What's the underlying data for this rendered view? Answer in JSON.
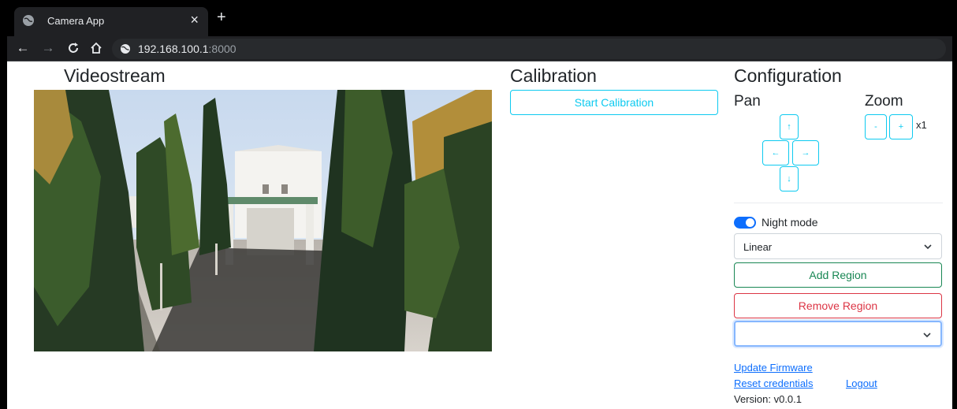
{
  "browser": {
    "tab_title": "Camera App",
    "tab_close": "×",
    "new_tab": "+",
    "url_host": "192.168.100.1",
    "url_port": ":8000"
  },
  "videostream": {
    "title": "Videostream"
  },
  "calibration": {
    "title": "Calibration",
    "start_label": "Start Calibration"
  },
  "configuration": {
    "title": "Configuration",
    "pan": {
      "title": "Pan",
      "up": "↑",
      "left": "←",
      "right": "→",
      "down": "↓"
    },
    "zoom": {
      "title": "Zoom",
      "minus": "-",
      "plus": "+",
      "level": "x1"
    },
    "night_mode": {
      "label": "Night mode",
      "enabled": true
    },
    "mode_select": {
      "value": "Linear"
    },
    "add_region_label": "Add Region",
    "remove_region_label": "Remove Region",
    "region_select": {
      "value": ""
    }
  },
  "footer": {
    "update_firmware": "Update Firmware",
    "reset_credentials": "Reset credentials",
    "logout": "Logout",
    "version": "Version: v0.0.1"
  },
  "colors": {
    "info": "#0dcaf0",
    "success": "#198754",
    "danger": "#dc3545",
    "primary": "#0d6efd"
  }
}
